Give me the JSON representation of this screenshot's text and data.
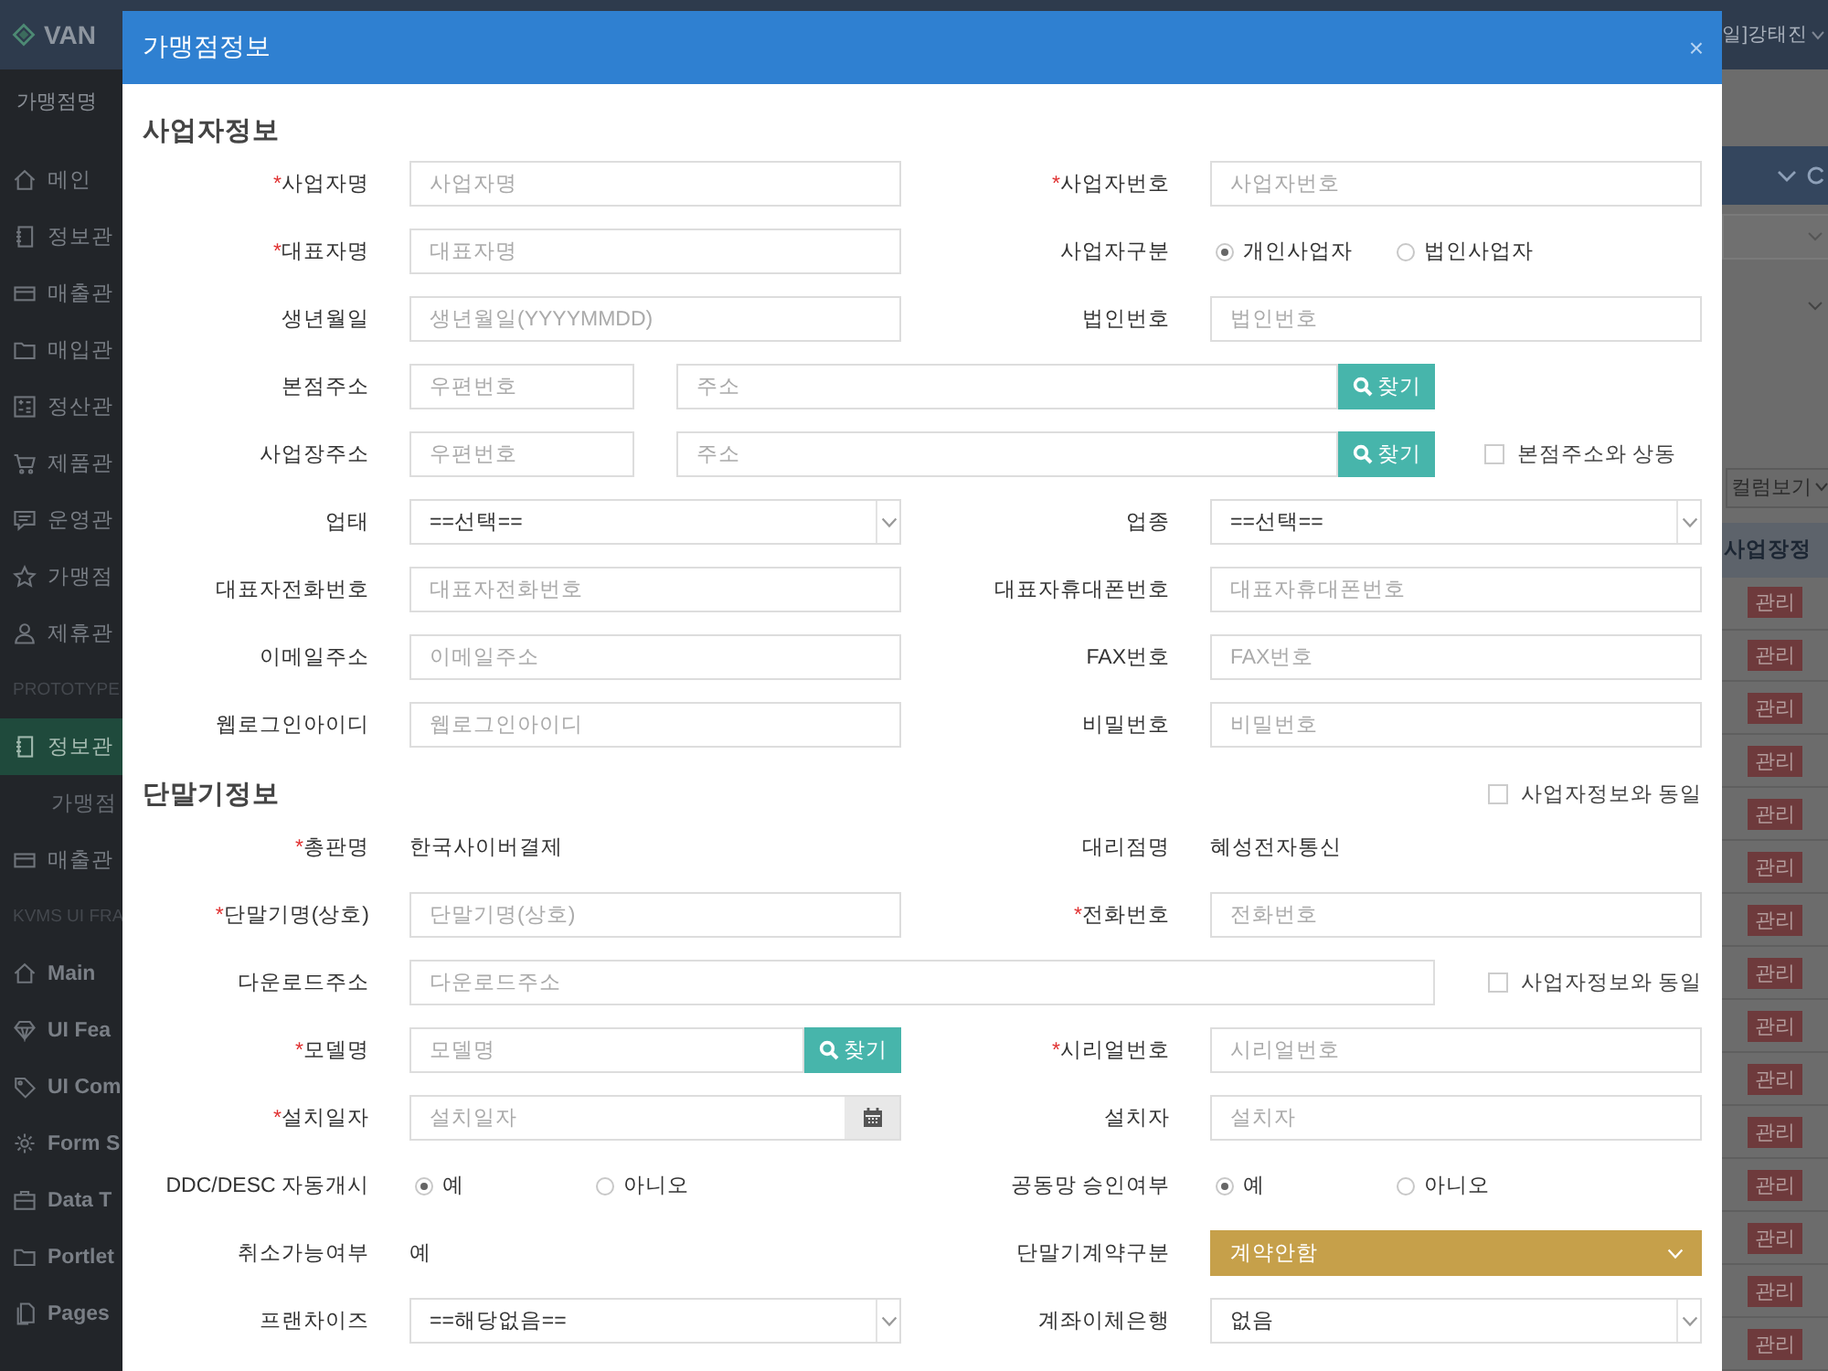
{
  "topbar": {
    "logo": "VAN",
    "user": "일]강태진"
  },
  "sidebar": {
    "search": "가맹점명",
    "items": [
      {
        "kind": "item",
        "label": "메인",
        "selected": false
      },
      {
        "kind": "item",
        "label": "정보관",
        "selected": false
      },
      {
        "kind": "item",
        "label": "매출관",
        "selected": false
      },
      {
        "kind": "item",
        "label": "매입관",
        "selected": false
      },
      {
        "kind": "item",
        "label": "정산관",
        "selected": false
      },
      {
        "kind": "item",
        "label": "제품관",
        "selected": false
      },
      {
        "kind": "item",
        "label": "운영관",
        "selected": false
      },
      {
        "kind": "item",
        "label": "가맹점",
        "selected": false
      },
      {
        "kind": "item",
        "label": "제휴관",
        "selected": false
      },
      {
        "kind": "heading",
        "label": "PROTOTYPE"
      },
      {
        "kind": "item",
        "label": "정보관",
        "selected": true
      },
      {
        "kind": "subitem",
        "label": "가맹점",
        "selected": false
      },
      {
        "kind": "item",
        "label": "매출관",
        "selected": false
      },
      {
        "kind": "heading",
        "label": "KVMS UI FRA"
      },
      {
        "kind": "item",
        "label": "Main",
        "selected": false
      },
      {
        "kind": "item",
        "label": "UI Fea",
        "selected": false
      },
      {
        "kind": "item",
        "label": "UI Com",
        "selected": false
      },
      {
        "kind": "item",
        "label": "Form S",
        "selected": false
      },
      {
        "kind": "item",
        "label": "Data T",
        "selected": false
      },
      {
        "kind": "item",
        "label": "Portlet",
        "selected": false
      },
      {
        "kind": "item",
        "label": "Pages",
        "selected": false
      }
    ]
  },
  "panel": {
    "column_button": "컬럼보기",
    "table_header": "사업장정",
    "rows": [
      "관리",
      "관리",
      "관리",
      "관리",
      "관리",
      "관리",
      "관리",
      "관리",
      "관리",
      "관리",
      "관리",
      "관리",
      "관리",
      "관리",
      "관리"
    ]
  },
  "modal": {
    "title": "가맹점정보",
    "close": "×",
    "sections": [
      {
        "title": "사업자정보",
        "rows": [
          {
            "fields": [
              {
                "label": "사업자명",
                "required": "*",
                "kind": "input",
                "placeholder": "사업자명"
              },
              {
                "label": "사업자번호",
                "required": "*",
                "kind": "input",
                "placeholder": "사업자번호"
              }
            ]
          },
          {
            "fields": [
              {
                "label": "대표자명",
                "required": "*",
                "kind": "input",
                "placeholder": "대표자명"
              },
              {
                "label": "사업자구분",
                "kind": "radio",
                "options": [
                  {
                    "label": "개인사업자",
                    "selected": true
                  },
                  {
                    "label": "법인사업자",
                    "selected": false
                  }
                ]
              }
            ]
          },
          {
            "fields": [
              {
                "label": "생년월일",
                "kind": "input",
                "placeholder": "생년월일(YYYYMMDD)"
              },
              {
                "label": "법인번호",
                "kind": "input",
                "placeholder": "법인번호"
              }
            ]
          },
          {
            "fields": [
              {
                "label": "본점주소",
                "kind": "address",
                "postal": "우편번호",
                "address": "주소",
                "button": "찾기"
              }
            ]
          },
          {
            "fields": [
              {
                "label": "사업장주소",
                "kind": "address",
                "postal": "우편번호",
                "address": "주소",
                "button": "찾기",
                "checkbox": {
                  "label": "본점주소와 상동",
                  "checked": false
                }
              }
            ]
          },
          {
            "fields": [
              {
                "label": "업태",
                "kind": "select",
                "value": "==선택==",
                "highlight": false
              },
              {
                "label": "업종",
                "kind": "select",
                "value": "==선택==",
                "highlight": false
              }
            ]
          },
          {
            "fields": [
              {
                "label": "대표자전화번호",
                "kind": "input",
                "placeholder": "대표자전화번호"
              },
              {
                "label": "대표자휴대폰번호",
                "kind": "input",
                "placeholder": "대표자휴대폰번호"
              }
            ]
          },
          {
            "fields": [
              {
                "label": "이메일주소",
                "kind": "input",
                "placeholder": "이메일주소"
              },
              {
                "label": "FAX번호",
                "kind": "input",
                "placeholder": "FAX번호"
              }
            ]
          },
          {
            "fields": [
              {
                "label": "웹로그인아이디",
                "kind": "input",
                "placeholder": "웹로그인아이디"
              },
              {
                "label": "비밀번호",
                "kind": "input",
                "placeholder": "비밀번호"
              }
            ]
          }
        ]
      },
      {
        "title": "단말기정보",
        "checkbox": {
          "label": "사업자정보와 동일",
          "checked": false
        },
        "rows": [
          {
            "fields": [
              {
                "label": "총판명",
                "required": "*",
                "kind": "text",
                "value": "한국사이버결제"
              },
              {
                "label": "대리점명",
                "kind": "text",
                "value": "혜성전자통신"
              }
            ]
          },
          {
            "fields": [
              {
                "label": "단말기명(상호)",
                "required": "*",
                "kind": "input",
                "placeholder": "단말기명(상호)"
              },
              {
                "label": "전화번호",
                "required": "*",
                "kind": "input",
                "placeholder": "전화번호"
              }
            ]
          },
          {
            "fields": [
              {
                "label": "다운로드주소",
                "kind": "wide",
                "placeholder": "다운로드주소",
                "checkbox": {
                  "label": "사업자정보와 동일",
                  "checked": false
                }
              }
            ]
          },
          {
            "fields": [
              {
                "label": "모델명",
                "required": "*",
                "kind": "search",
                "placeholder": "모델명",
                "button": "찾기"
              },
              {
                "label": "시리얼번호",
                "required": "*",
                "kind": "input",
                "placeholder": "시리얼번호"
              }
            ]
          },
          {
            "fields": [
              {
                "label": "설치일자",
                "required": "*",
                "kind": "date",
                "placeholder": "설치일자"
              },
              {
                "label": "설치자",
                "kind": "input",
                "placeholder": "설치자"
              }
            ]
          },
          {
            "fields": [
              {
                "label": "DDC/DESC 자동개시",
                "kind": "radio",
                "options": [
                  {
                    "label": "예",
                    "selected": true
                  },
                  {
                    "label": "아니오",
                    "selected": false
                  }
                ]
              },
              {
                "label": "공동망 승인여부",
                "kind": "radio",
                "options": [
                  {
                    "label": "예",
                    "selected": true
                  },
                  {
                    "label": "아니오",
                    "selected": false
                  }
                ]
              }
            ]
          },
          {
            "fields": [
              {
                "label": "취소가능여부",
                "kind": "text",
                "value": "예"
              },
              {
                "label": "단말기계약구분",
                "kind": "select",
                "value": "계약안함",
                "highlight": true
              }
            ]
          },
          {
            "fields": [
              {
                "label": "프랜차이즈",
                "kind": "select",
                "value": "==해당없음==",
                "highlight": false
              },
              {
                "label": "계좌이체은행",
                "kind": "select",
                "value": "없음",
                "highlight": false
              }
            ]
          }
        ]
      }
    ]
  }
}
